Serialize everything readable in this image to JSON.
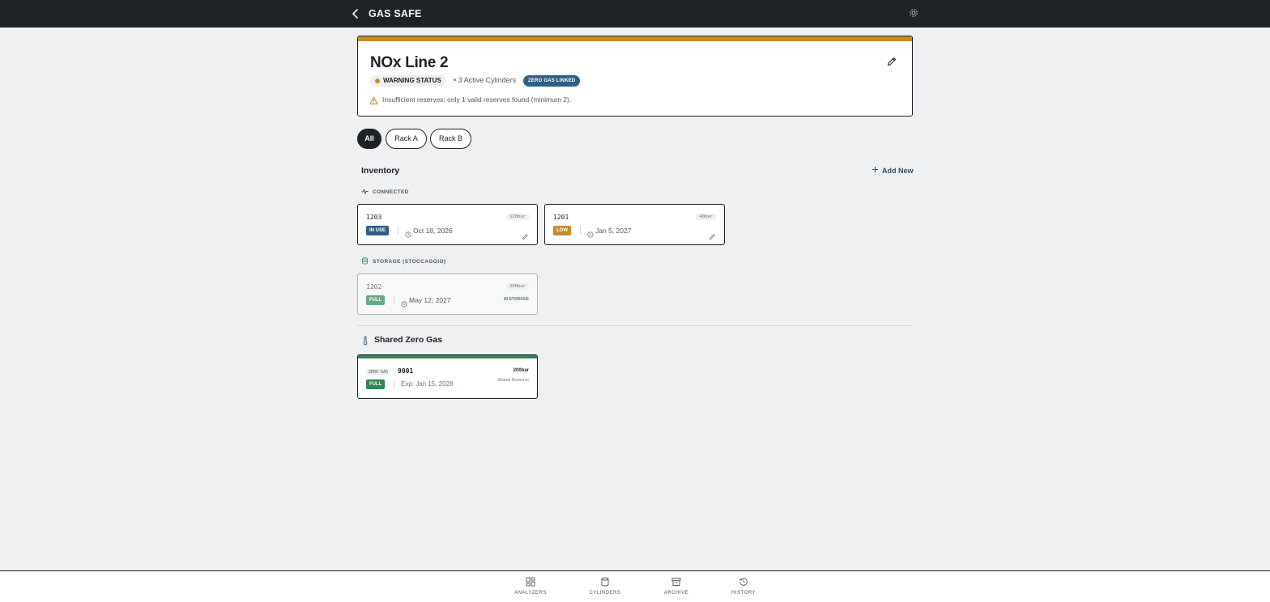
{
  "app": {
    "title": "GAS SAFE",
    "back_icon": "chevron-left-icon",
    "settings_icon": "gear-icon"
  },
  "analyzer": {
    "name": "NOx Line 2",
    "status_label": "WARNING STATUS",
    "status_color": "#c98a2e",
    "active_cylinders": "• 3 Active Cylinders",
    "zero_badge": "ZERO GAS LINKED",
    "warning": "Insufficient reserves: only 1 valid reserves found (minimum 2)."
  },
  "filters": [
    {
      "label": "All",
      "active": true
    },
    {
      "label": "Rack A",
      "active": false
    },
    {
      "label": "Rack B",
      "active": false
    }
  ],
  "inventory": {
    "title": "Inventory",
    "add_new": "Add New",
    "connected_label": "CONNECTED",
    "storage_label": "STORAGE (STOCCAGGIO)",
    "connected": [
      {
        "serial": "1203",
        "pressure": "120bar",
        "status": "IN USE",
        "status_color": "#2f5f86",
        "date": "Oct 18, 2026"
      },
      {
        "serial": "1201",
        "pressure": "40bar",
        "status": "LOW",
        "status_color": "#c98a2e",
        "date": "Jan 5, 2027"
      }
    ],
    "storage": [
      {
        "serial": "1202",
        "pressure": "200bar",
        "status": "FULL",
        "status_color": "#6aa884",
        "date": "May 12, 2027",
        "tag": "IN STORAGE"
      }
    ]
  },
  "shared_zero_gas": {
    "title": "Shared Zero Gas",
    "card": {
      "type_tag": "ZERO GAS",
      "serial": "9001",
      "pressure": "200bar",
      "shared_label": "Shared Resource",
      "status": "FULL",
      "expiry": "Exp: Jan 15, 2028"
    }
  },
  "bottom_nav": [
    {
      "label": "ANALYZERS",
      "icon": "grid-icon"
    },
    {
      "label": "CYLINDERS",
      "icon": "cylinder-icon"
    },
    {
      "label": "ARCHIVE",
      "icon": "archive-box-icon"
    },
    {
      "label": "HISTORY",
      "icon": "history-icon"
    }
  ]
}
